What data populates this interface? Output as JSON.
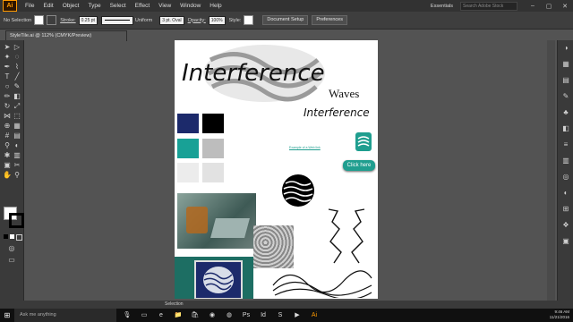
{
  "app": {
    "logo": "Ai",
    "workspace": "Essentials",
    "search_placeholder": "Search Adobe Stock"
  },
  "menu": [
    "File",
    "Edit",
    "Object",
    "Type",
    "Select",
    "Effect",
    "View",
    "Window",
    "Help"
  ],
  "window_controls": [
    "–",
    "▢",
    "✕"
  ],
  "control_bar": {
    "selection": "No Selection",
    "stroke_label": "Stroke:",
    "stroke_value": "0.25 pt",
    "uniform": "Uniform",
    "brush": "3 pt. Oval",
    "opacity_label": "Opacity:",
    "opacity_value": "100%",
    "style_label": "Style:",
    "doc_setup": "Document Setup",
    "preferences": "Preferences"
  },
  "document_tab": "StyleTile.ai @ 112% (CMYK/Preview)",
  "artboard": {
    "heading": "Interference",
    "sub1": "Waves",
    "sub2": "Interference",
    "link_text": "Example of a Web link",
    "button_label": "Click here",
    "swatches": [
      "#1c2a6b",
      "#000000",
      "#18a196",
      "#bdbdbd"
    ]
  },
  "status": {
    "tool": "Selection"
  },
  "taskbar": {
    "ask": "Ask me anything",
    "time": "9:46 AM",
    "date": "11/21/2016"
  }
}
